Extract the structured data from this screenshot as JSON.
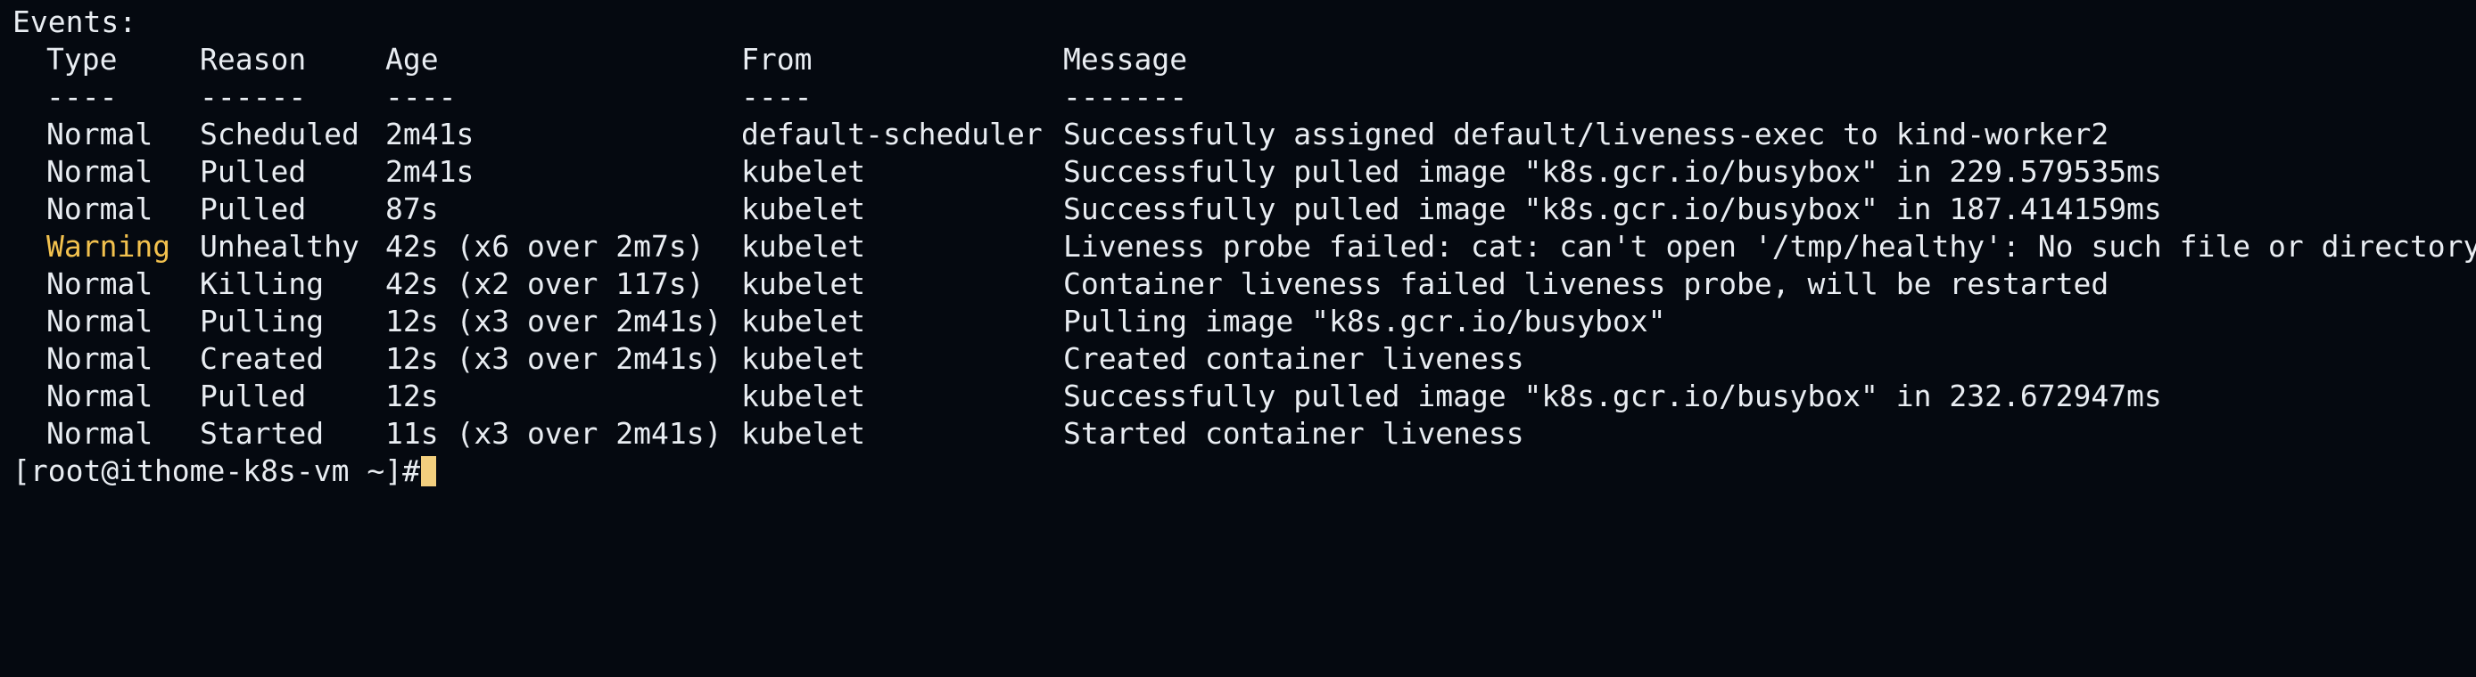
{
  "events_label": "Events:",
  "header": {
    "type": "Type",
    "reason": "Reason",
    "age": "Age",
    "from": "From",
    "message": "Message"
  },
  "separator": {
    "type": "----",
    "reason": "------",
    "age": "----",
    "from": "----",
    "message": "-------"
  },
  "events": [
    {
      "type": "Normal",
      "reason": "Scheduled",
      "age": "2m41s",
      "from": "default-scheduler",
      "message": "Successfully assigned default/liveness-exec to kind-worker2"
    },
    {
      "type": "Normal",
      "reason": "Pulled",
      "age": "2m41s",
      "from": "kubelet",
      "message": "Successfully pulled image \"k8s.gcr.io/busybox\" in 229.579535ms"
    },
    {
      "type": "Normal",
      "reason": "Pulled",
      "age": "87s",
      "from": "kubelet",
      "message": "Successfully pulled image \"k8s.gcr.io/busybox\" in 187.414159ms"
    },
    {
      "type": "Warning",
      "reason": "Unhealthy",
      "age": "42s (x6 over 2m7s)",
      "from": "kubelet",
      "message": "Liveness probe failed: cat: can't open '/tmp/healthy': No such file or directory"
    },
    {
      "type": "Normal",
      "reason": "Killing",
      "age": "42s (x2 over 117s)",
      "from": "kubelet",
      "message": "Container liveness failed liveness probe, will be restarted"
    },
    {
      "type": "Normal",
      "reason": "Pulling",
      "age": "12s (x3 over 2m41s)",
      "from": "kubelet",
      "message": "Pulling image \"k8s.gcr.io/busybox\""
    },
    {
      "type": "Normal",
      "reason": "Created",
      "age": "12s (x3 over 2m41s)",
      "from": "kubelet",
      "message": "Created container liveness"
    },
    {
      "type": "Normal",
      "reason": "Pulled",
      "age": "12s",
      "from": "kubelet",
      "message": "Successfully pulled image \"k8s.gcr.io/busybox\" in 232.672947ms"
    },
    {
      "type": "Normal",
      "reason": "Started",
      "age": "11s (x3 over 2m41s)",
      "from": "kubelet",
      "message": "Started container liveness"
    }
  ],
  "prompt": "[root@ithome-k8s-vm ~]#",
  "colors": {
    "background": "#050910",
    "text": "#e9edf2",
    "warning": "#f2c14e",
    "cursor": "#f3cf7e"
  }
}
